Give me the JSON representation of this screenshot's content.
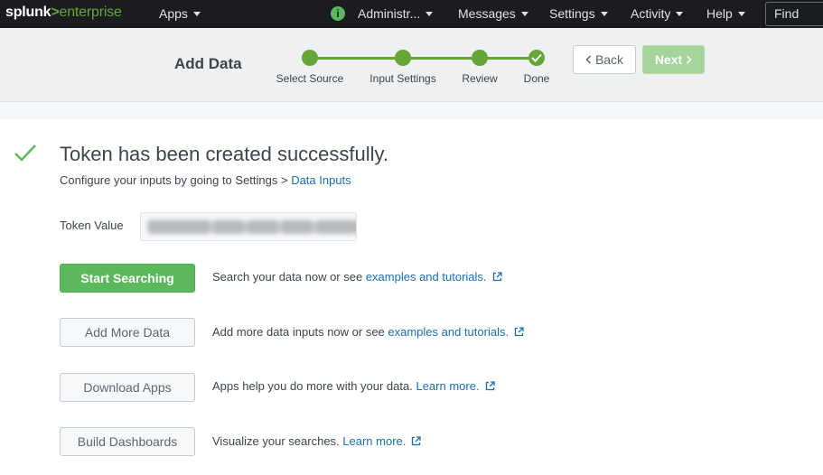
{
  "topbar": {
    "logo_main": "splunk",
    "logo_gt": ">",
    "logo_sub": "enterprise",
    "apps": "Apps",
    "admin": "Administr...",
    "admin_badge": "i",
    "messages": "Messages",
    "settings": "Settings",
    "activity": "Activity",
    "help": "Help",
    "find": "Find"
  },
  "wizard": {
    "title": "Add Data",
    "steps": [
      {
        "label": "Select Source",
        "state": "complete"
      },
      {
        "label": "Input Settings",
        "state": "complete"
      },
      {
        "label": "Review",
        "state": "complete"
      },
      {
        "label": "Done",
        "state": "current"
      }
    ],
    "back_label": "Back",
    "next_label": "Next"
  },
  "result": {
    "title": "Token has been created successfully.",
    "config_text": "Configure your inputs by going to Settings > ",
    "config_link": "Data Inputs",
    "token_label": "Token Value",
    "token_value": "████████-████-████-████-████████████"
  },
  "actions": [
    {
      "button": "Start Searching",
      "text": "Search your data now or see ",
      "link": "examples and tutorials.",
      "primary": true
    },
    {
      "button": "Add More Data",
      "text": "Add more data inputs now or see ",
      "link": "examples and tutorials.",
      "primary": false
    },
    {
      "button": "Download Apps",
      "text": "Apps help you do more with your data. ",
      "link": "Learn more.",
      "primary": false
    },
    {
      "button": "Build Dashboards",
      "text": "Visualize your searches. ",
      "link": "Learn more.",
      "primary": false
    }
  ],
  "colors": {
    "brand_green": "#65a637",
    "success_green": "#5cb85c",
    "link_blue": "#1a6fb3",
    "topbar_bg": "#1a1c20"
  }
}
